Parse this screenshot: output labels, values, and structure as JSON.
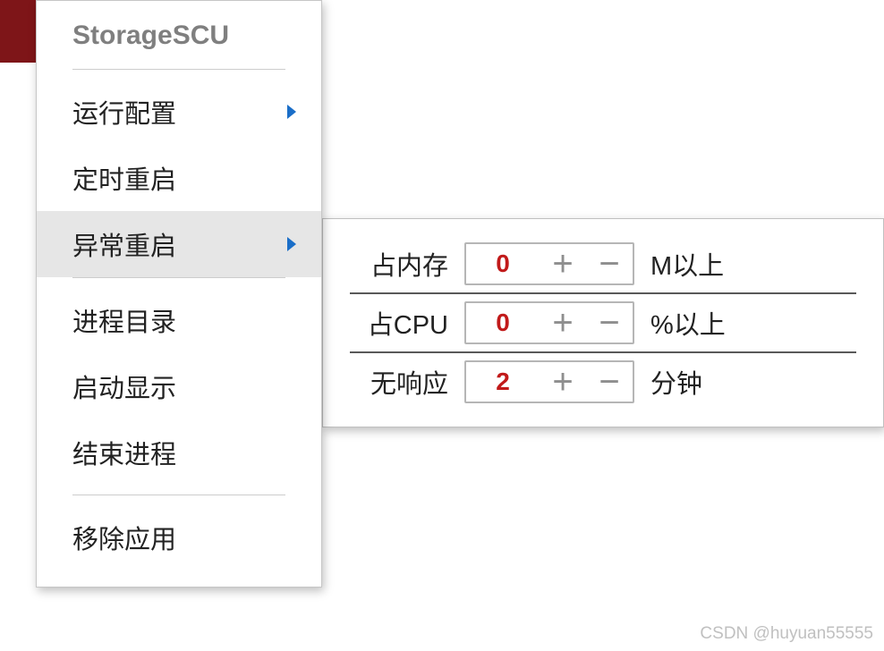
{
  "menu": {
    "title": "StorageSCU",
    "items": [
      {
        "label": "运行配置",
        "has_submenu": true,
        "active": false
      },
      {
        "label": "定时重启",
        "has_submenu": false,
        "active": false
      },
      {
        "label": "异常重启",
        "has_submenu": true,
        "active": true
      },
      {
        "label": "进程目录",
        "has_submenu": false,
        "active": false
      },
      {
        "label": "启动显示",
        "has_submenu": false,
        "active": false
      },
      {
        "label": "结束进程",
        "has_submenu": false,
        "active": false
      },
      {
        "label": "移除应用",
        "has_submenu": false,
        "active": false
      }
    ]
  },
  "submenu": {
    "rows": [
      {
        "label": "占内存",
        "value": "0",
        "suffix": "M以上"
      },
      {
        "label": "占CPU",
        "value": "0",
        "suffix": "%以上"
      },
      {
        "label": "无响应",
        "value": "2",
        "suffix": "分钟"
      }
    ]
  },
  "watermark": "CSDN @huyuan55555"
}
